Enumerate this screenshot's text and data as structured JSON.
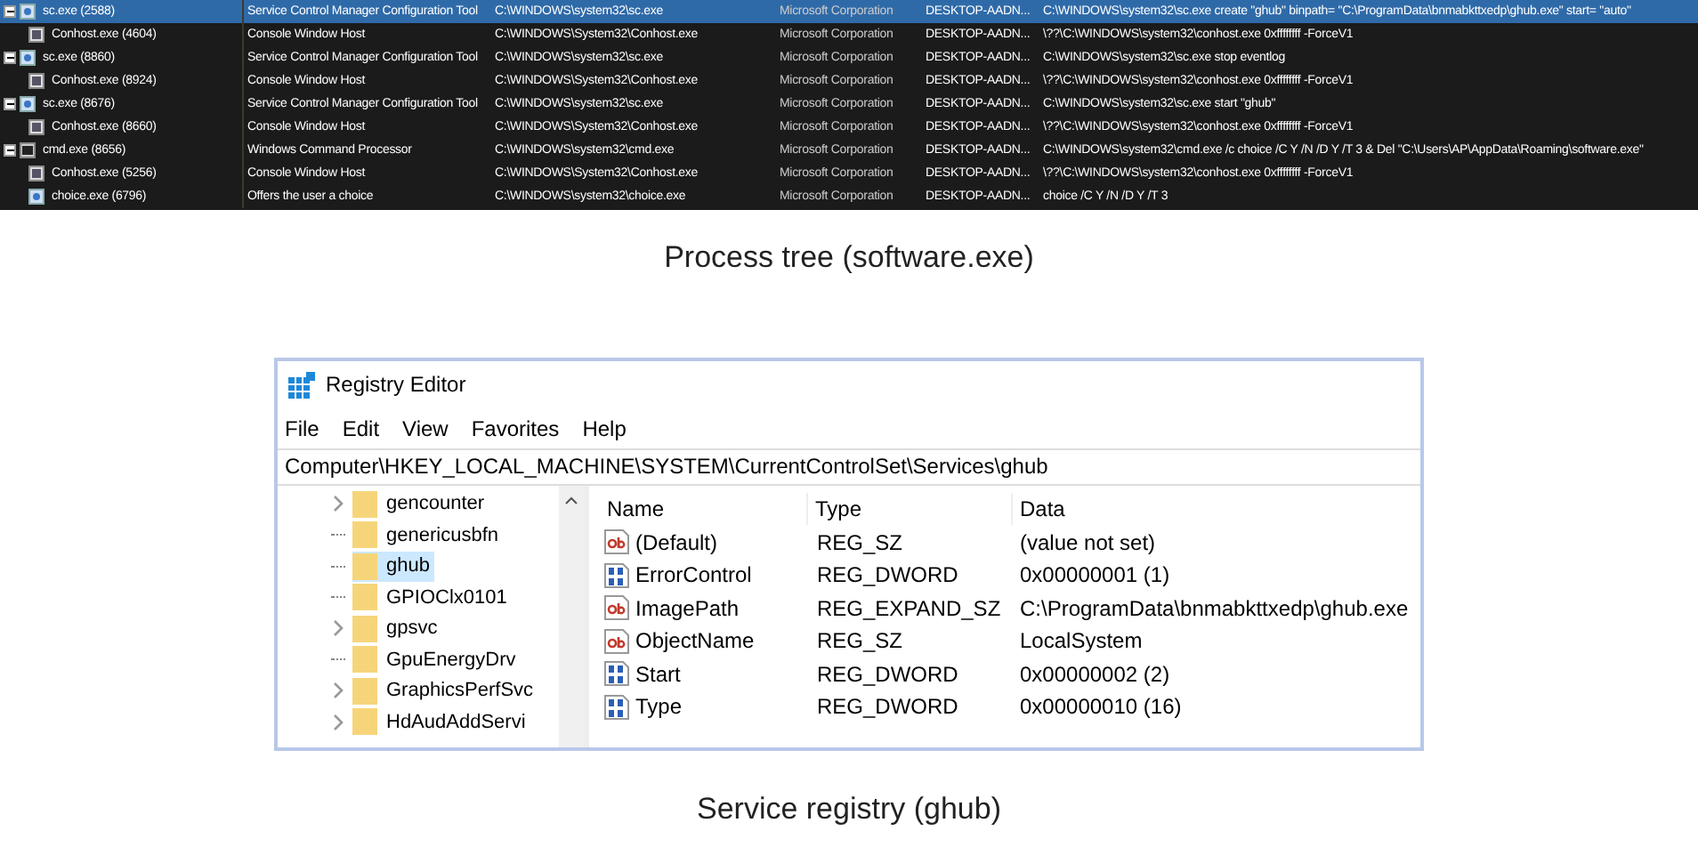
{
  "process_tree": {
    "rows": [
      {
        "name": "sc.exe (2588)",
        "kind": "sc",
        "expanded": true,
        "selected": true,
        "description": "Service Control Manager Configuration Tool",
        "path": "C:\\WINDOWS\\system32\\sc.exe",
        "company": "Microsoft Corporation",
        "user": "DESKTOP-AADN...",
        "command": "C:\\WINDOWS\\system32\\sc.exe create \"ghub\" binpath= \"C:\\ProgramData\\bnmabkttxedp\\ghub.exe\" start= \"auto\"",
        "children": [
          {
            "name": "Conhost.exe (4604)",
            "kind": "conhost",
            "selected": false,
            "description": "Console Window Host",
            "path": "C:\\WINDOWS\\System32\\Conhost.exe",
            "company": "Microsoft Corporation",
            "user": "DESKTOP-AADN...",
            "command": "\\??\\C:\\WINDOWS\\system32\\conhost.exe 0xffffffff -ForceV1"
          }
        ]
      },
      {
        "name": "sc.exe (8860)",
        "kind": "sc",
        "expanded": true,
        "selected": false,
        "description": "Service Control Manager Configuration Tool",
        "path": "C:\\WINDOWS\\system32\\sc.exe",
        "company": "Microsoft Corporation",
        "user": "DESKTOP-AADN...",
        "command": "C:\\WINDOWS\\system32\\sc.exe stop eventlog",
        "children": [
          {
            "name": "Conhost.exe (8924)",
            "kind": "conhost",
            "selected": false,
            "description": "Console Window Host",
            "path": "C:\\WINDOWS\\System32\\Conhost.exe",
            "company": "Microsoft Corporation",
            "user": "DESKTOP-AADN...",
            "command": "\\??\\C:\\WINDOWS\\system32\\conhost.exe 0xffffffff -ForceV1"
          }
        ]
      },
      {
        "name": "sc.exe (8676)",
        "kind": "sc",
        "expanded": true,
        "selected": false,
        "description": "Service Control Manager Configuration Tool",
        "path": "C:\\WINDOWS\\system32\\sc.exe",
        "company": "Microsoft Corporation",
        "user": "DESKTOP-AADN...",
        "command": "C:\\WINDOWS\\system32\\sc.exe start \"ghub\"",
        "children": [
          {
            "name": "Conhost.exe (8660)",
            "kind": "conhost",
            "selected": false,
            "description": "Console Window Host",
            "path": "C:\\WINDOWS\\System32\\Conhost.exe",
            "company": "Microsoft Corporation",
            "user": "DESKTOP-AADN...",
            "command": "\\??\\C:\\WINDOWS\\system32\\conhost.exe 0xffffffff -ForceV1"
          }
        ]
      },
      {
        "name": "cmd.exe (8656)",
        "kind": "cmd",
        "expanded": true,
        "selected": false,
        "description": "Windows Command Processor",
        "path": "C:\\WINDOWS\\system32\\cmd.exe",
        "company": "Microsoft Corporation",
        "user": "DESKTOP-AADN...",
        "command": "C:\\WINDOWS\\system32\\cmd.exe /c choice /C Y /N /D Y /T 3 & Del \"C:\\Users\\AP\\AppData\\Roaming\\software.exe\"",
        "children": [
          {
            "name": "Conhost.exe (5256)",
            "kind": "conhost",
            "selected": false,
            "description": "Console Window Host",
            "path": "C:\\WINDOWS\\System32\\Conhost.exe",
            "company": "Microsoft Corporation",
            "user": "DESKTOP-AADN...",
            "command": "\\??\\C:\\WINDOWS\\system32\\conhost.exe 0xffffffff -ForceV1"
          },
          {
            "name": "choice.exe (6796)",
            "kind": "sc",
            "selected": false,
            "description": "Offers the user a choice",
            "path": "C:\\WINDOWS\\system32\\choice.exe",
            "company": "Microsoft Corporation",
            "user": "DESKTOP-AADN...",
            "command": "choice  /C Y /N /D Y /T 3"
          }
        ]
      }
    ]
  },
  "caption_1": "Process tree (software.exe)",
  "registry_editor": {
    "title": "Registry Editor",
    "menu": [
      "File",
      "Edit",
      "View",
      "Favorites",
      "Help"
    ],
    "address": "Computer\\HKEY_LOCAL_MACHINE\\SYSTEM\\CurrentControlSet\\Services\\ghub",
    "tree": [
      {
        "label": "gencounter",
        "expandable": true,
        "selected": false
      },
      {
        "label": "genericusbfn",
        "expandable": false,
        "selected": false
      },
      {
        "label": "ghub",
        "expandable": false,
        "selected": true
      },
      {
        "label": "GPIOClx0101",
        "expandable": false,
        "selected": false
      },
      {
        "label": "gpsvc",
        "expandable": true,
        "selected": false
      },
      {
        "label": "GpuEnergyDrv",
        "expandable": false,
        "selected": false
      },
      {
        "label": "GraphicsPerfSvc",
        "expandable": true,
        "selected": false
      },
      {
        "label": "HdAudAddServi",
        "expandable": true,
        "selected": false
      }
    ],
    "columns": [
      "Name",
      "Type",
      "Data"
    ],
    "values": [
      {
        "kind": "string",
        "name": "(Default)",
        "type": "REG_SZ",
        "data": "(value not set)"
      },
      {
        "kind": "binary",
        "name": "ErrorControl",
        "type": "REG_DWORD",
        "data": "0x00000001 (1)"
      },
      {
        "kind": "string",
        "name": "ImagePath",
        "type": "REG_EXPAND_SZ",
        "data": "C:\\ProgramData\\bnmabkttxedp\\ghub.exe"
      },
      {
        "kind": "string",
        "name": "ObjectName",
        "type": "REG_SZ",
        "data": "LocalSystem"
      },
      {
        "kind": "binary",
        "name": "Start",
        "type": "REG_DWORD",
        "data": "0x00000002 (2)"
      },
      {
        "kind": "binary",
        "name": "Type",
        "type": "REG_DWORD",
        "data": "0x00000010 (16)"
      }
    ]
  },
  "caption_2": "Service registry (ghub)"
}
